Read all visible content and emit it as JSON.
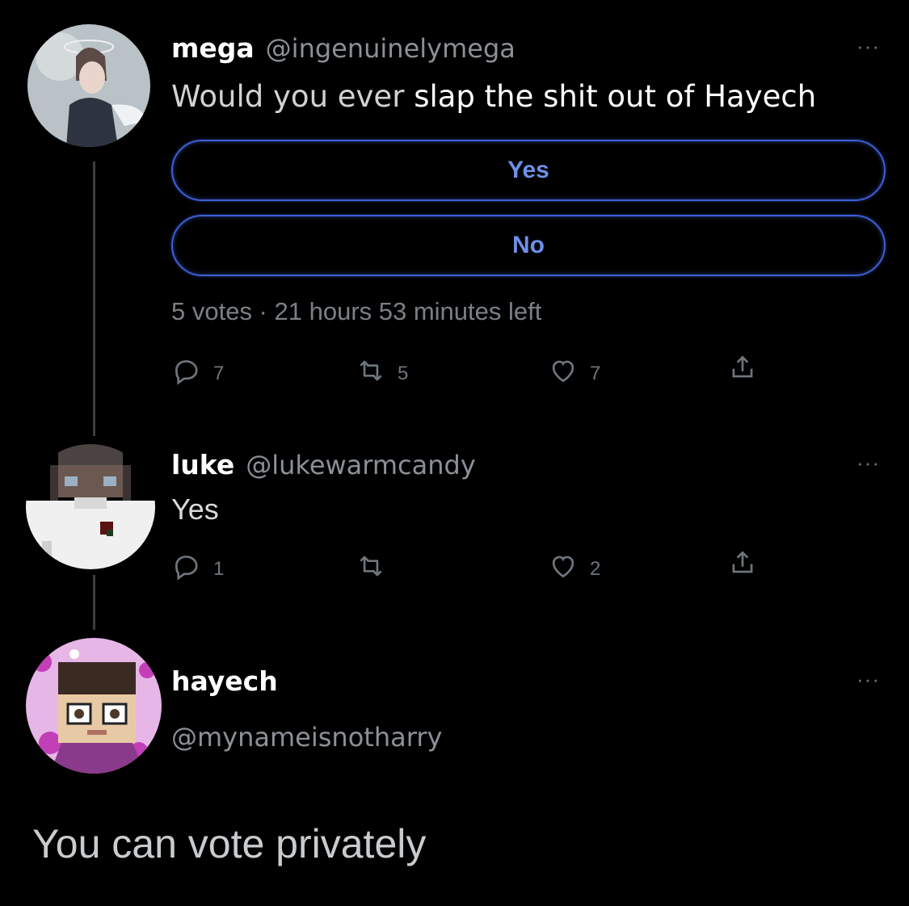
{
  "tweets": [
    {
      "name": "mega",
      "handle": "@ingenuinelymega",
      "text_plain": "Would you ever",
      "text_emph": "slap the shit out of Hayech",
      "more": "···",
      "poll": {
        "options": [
          "Yes",
          "No"
        ],
        "meta": "5 votes · 21 hours 53 minutes left"
      },
      "actions": {
        "replies": "7",
        "retweets": "5",
        "likes": "7"
      }
    },
    {
      "name": "luke",
      "handle": "@lukewarmcandy",
      "text": "Yes",
      "more": "···",
      "actions": {
        "replies": "1",
        "retweets": "",
        "likes": "2"
      }
    },
    {
      "name": "hayech",
      "handle": "@mynameisnotharry",
      "text": "You can vote privately",
      "more": "···"
    }
  ],
  "colors": {
    "background": "#000000",
    "poll_border": "#3d5fd6",
    "poll_text": "#6f8fe8",
    "muted": "#6e767d"
  },
  "icons": [
    "reply-icon",
    "retweet-icon",
    "like-icon",
    "share-icon",
    "more-icon"
  ]
}
